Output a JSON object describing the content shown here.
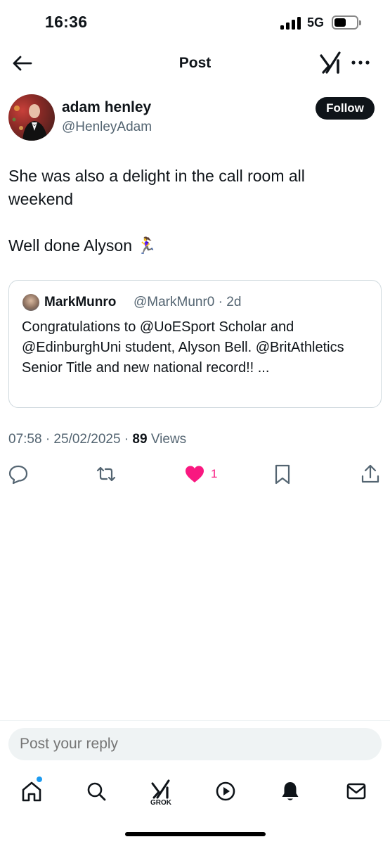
{
  "status_bar": {
    "time": "16:36",
    "network": "5G"
  },
  "header": {
    "title": "Post",
    "back_icon": "arrow-left-icon",
    "grok_icon": "grok-icon",
    "more_icon": "more-icon"
  },
  "author": {
    "name": "adam henley",
    "handle": "@HenleyAdam",
    "follow_label": "Follow"
  },
  "tweet": {
    "text": "She was also a delight in the call room all weekend\n\nWell done Alyson 🏃‍♀️"
  },
  "quote": {
    "name": "MarkMunro",
    "handle_time": "@MarkMunr0 · 2d",
    "text": "Congratulations to @UoESport Scholar and @EdinburghUni student, Alyson Bell. @BritAthletics Senior Title and new national record!! ..."
  },
  "meta": {
    "datetime": "07:58 · 25/02/2025 · ",
    "views_count": "89",
    "views_label": " Views"
  },
  "actions": {
    "like_count": "1",
    "like_color": "#f91880"
  },
  "reply": {
    "placeholder": "Post your reply"
  },
  "tabbar": {
    "grok_label": "GROK",
    "accent": "#1d9bf0"
  }
}
